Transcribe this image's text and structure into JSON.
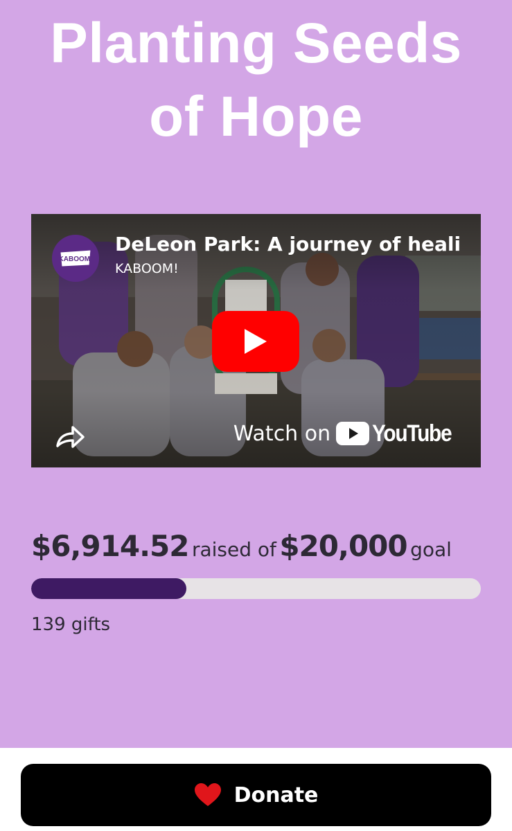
{
  "page": {
    "title": "Planting Seeds\nof Hope",
    "background_color": "#d3a6e6"
  },
  "video": {
    "title": "DeLeon Park: A journey of heali",
    "channel": "KABOOM!",
    "channel_avatar_text": "KABOOM!",
    "watch_on_label": "Watch on",
    "youtube_label": "YouTube",
    "play_icon": "play-icon",
    "share_icon": "share-icon",
    "play_color": "#ff0000"
  },
  "fundraiser": {
    "raised": "$6,914.52",
    "raised_text": "raised of",
    "goal": "$20,000",
    "goal_text": "goal",
    "progress_fraction": 0.3457,
    "progress_color": "#3e1a63",
    "gifts": "139 gifts"
  },
  "footer": {
    "donate_label": "Donate",
    "donate_icon": "heart-icon",
    "heart_color": "#e0161b"
  }
}
